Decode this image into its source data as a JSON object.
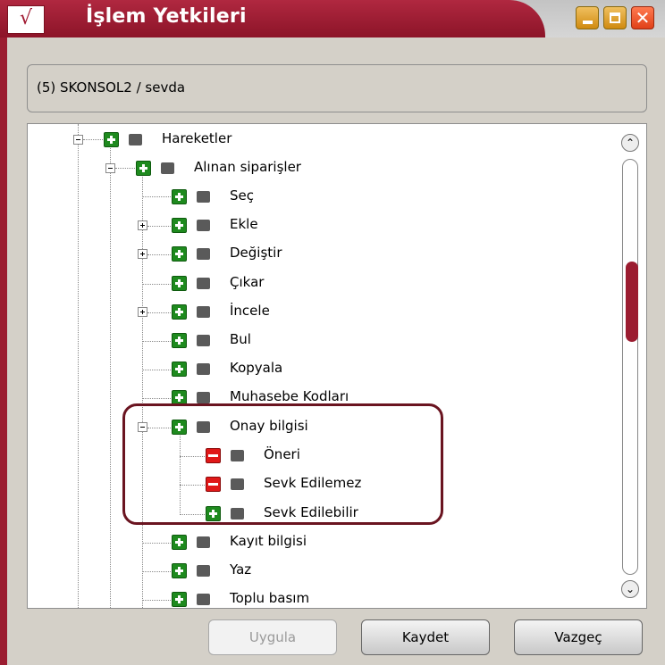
{
  "window": {
    "title": "İşlem Yetkileri",
    "app_icon_glyph": "√",
    "controls": {
      "minimize": "minimize-icon",
      "maximize": "maximize-icon",
      "close_glyph": "✕"
    }
  },
  "header": {
    "text": "(5) SKONSOL2 / sevda"
  },
  "tree": {
    "items": [
      {
        "label": "Hareketler",
        "icon": "grant"
      },
      {
        "label": "Alınan siparişler",
        "icon": "grant"
      },
      {
        "label": "Seç",
        "icon": "grant"
      },
      {
        "label": "Ekle",
        "icon": "grant"
      },
      {
        "label": "Değiştir",
        "icon": "grant"
      },
      {
        "label": "Çıkar",
        "icon": "grant"
      },
      {
        "label": "İncele",
        "icon": "grant"
      },
      {
        "label": "Bul",
        "icon": "grant"
      },
      {
        "label": "Kopyala",
        "icon": "grant"
      },
      {
        "label": "Muhasebe Kodları",
        "icon": "grant"
      },
      {
        "label": "Onay bilgisi",
        "icon": "grant"
      },
      {
        "label": "Öneri",
        "icon": "deny"
      },
      {
        "label": "Sevk Edilemez",
        "icon": "deny"
      },
      {
        "label": "Sevk Edilebilir",
        "icon": "grant"
      },
      {
        "label": "Kayıt bilgisi",
        "icon": "grant"
      },
      {
        "label": "Yaz",
        "icon": "grant"
      },
      {
        "label": "Toplu basım",
        "icon": "grant"
      }
    ]
  },
  "scrollbar": {
    "up_glyph": "⌃",
    "down_glyph": "⌄"
  },
  "buttons": {
    "apply": "Uygula",
    "save": "Kaydet",
    "cancel": "Vazgeç"
  },
  "colors": {
    "accent": "#9b1c30",
    "grant": "#1e8a1e",
    "deny": "#e01818",
    "highlight": "#6a1420"
  }
}
